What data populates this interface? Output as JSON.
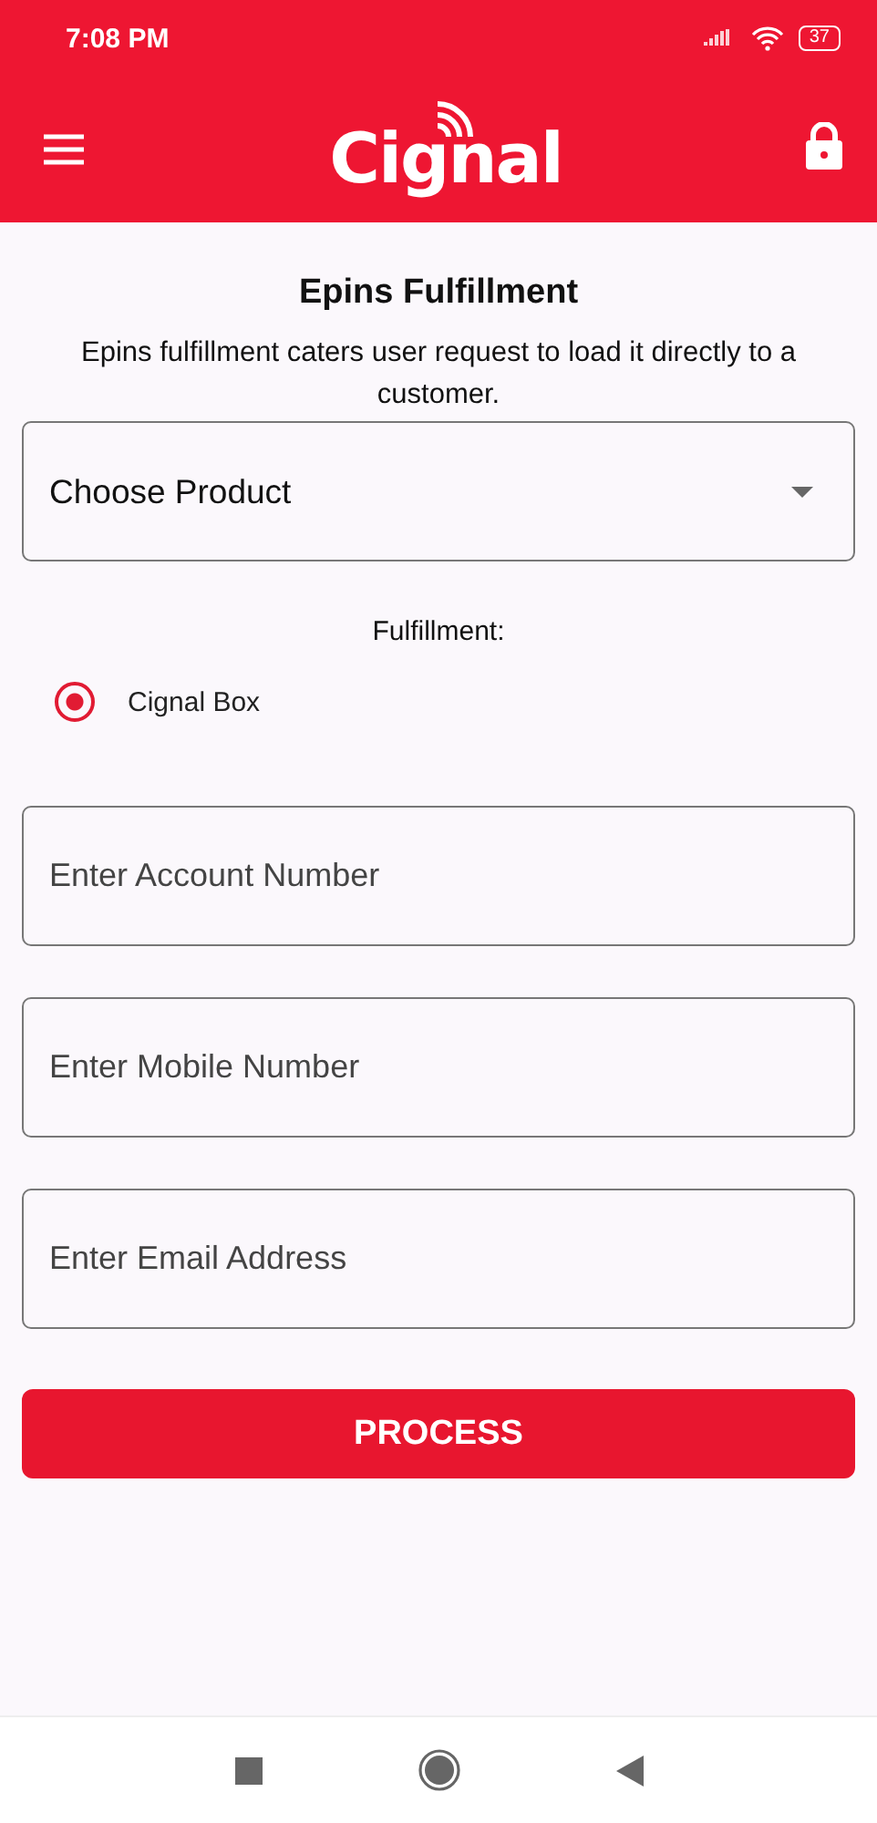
{
  "status_bar": {
    "time": "7:08 PM",
    "battery": "37"
  },
  "app_bar": {
    "logo": "Cignal"
  },
  "title": "Epins Fulfillment",
  "description": "Epins fulfillment caters user request to load it directly to a customer.",
  "product_dropdown": {
    "placeholder": "Choose Product"
  },
  "fulfillment": {
    "label": "Fulfillment:",
    "options": [
      {
        "label": "Cignal Box",
        "selected": true
      }
    ]
  },
  "fields": [
    {
      "placeholder": "Enter Account Number"
    },
    {
      "placeholder": "Enter Mobile Number"
    },
    {
      "placeholder": "Enter Email Address"
    }
  ],
  "button": "PROCESS"
}
